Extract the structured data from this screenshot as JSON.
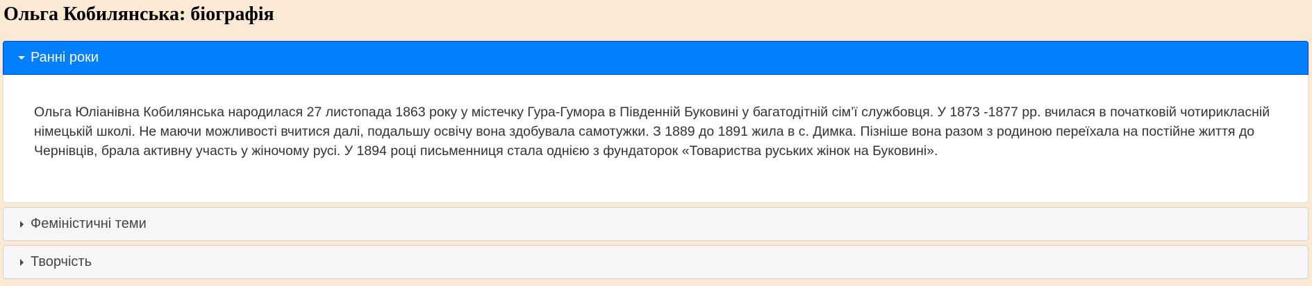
{
  "page": {
    "title": "Ольга Кобилянська: біографія"
  },
  "accordion": {
    "panels": [
      {
        "label": "Ранні роки",
        "expanded": true,
        "content": "Ольга Юліанівна Кобилянська народилася 27 листопада 1863 року у містечку Гура-Гумора в Південній Буковині у багатодітній сім’ї службовця. У 1873 -1877 рр. вчилася в початковій чотирикласній німецькій школі. Не маючи можливості вчитися далі, подальшу освічу вона здобувала самотужки. З 1889 до 1891 жила в с. Димка. Пізніше вона разом з родиною переїхала на постійне життя до Чернівців, брала активну участь у жіночому русі. У 1894 році письменниця стала однією з фундаторок «Товариства руських жінок на Буковині»."
      },
      {
        "label": "Феміністичні теми",
        "expanded": false
      },
      {
        "label": "Творчість",
        "expanded": false
      }
    ]
  },
  "colors": {
    "page_background": "#fbe9d4",
    "active_header": "#007fff",
    "inactive_header": "#f6f6f6",
    "content_background": "#ffffff"
  },
  "icons": {
    "expanded": "triangle-down-icon",
    "collapsed": "triangle-right-icon"
  }
}
